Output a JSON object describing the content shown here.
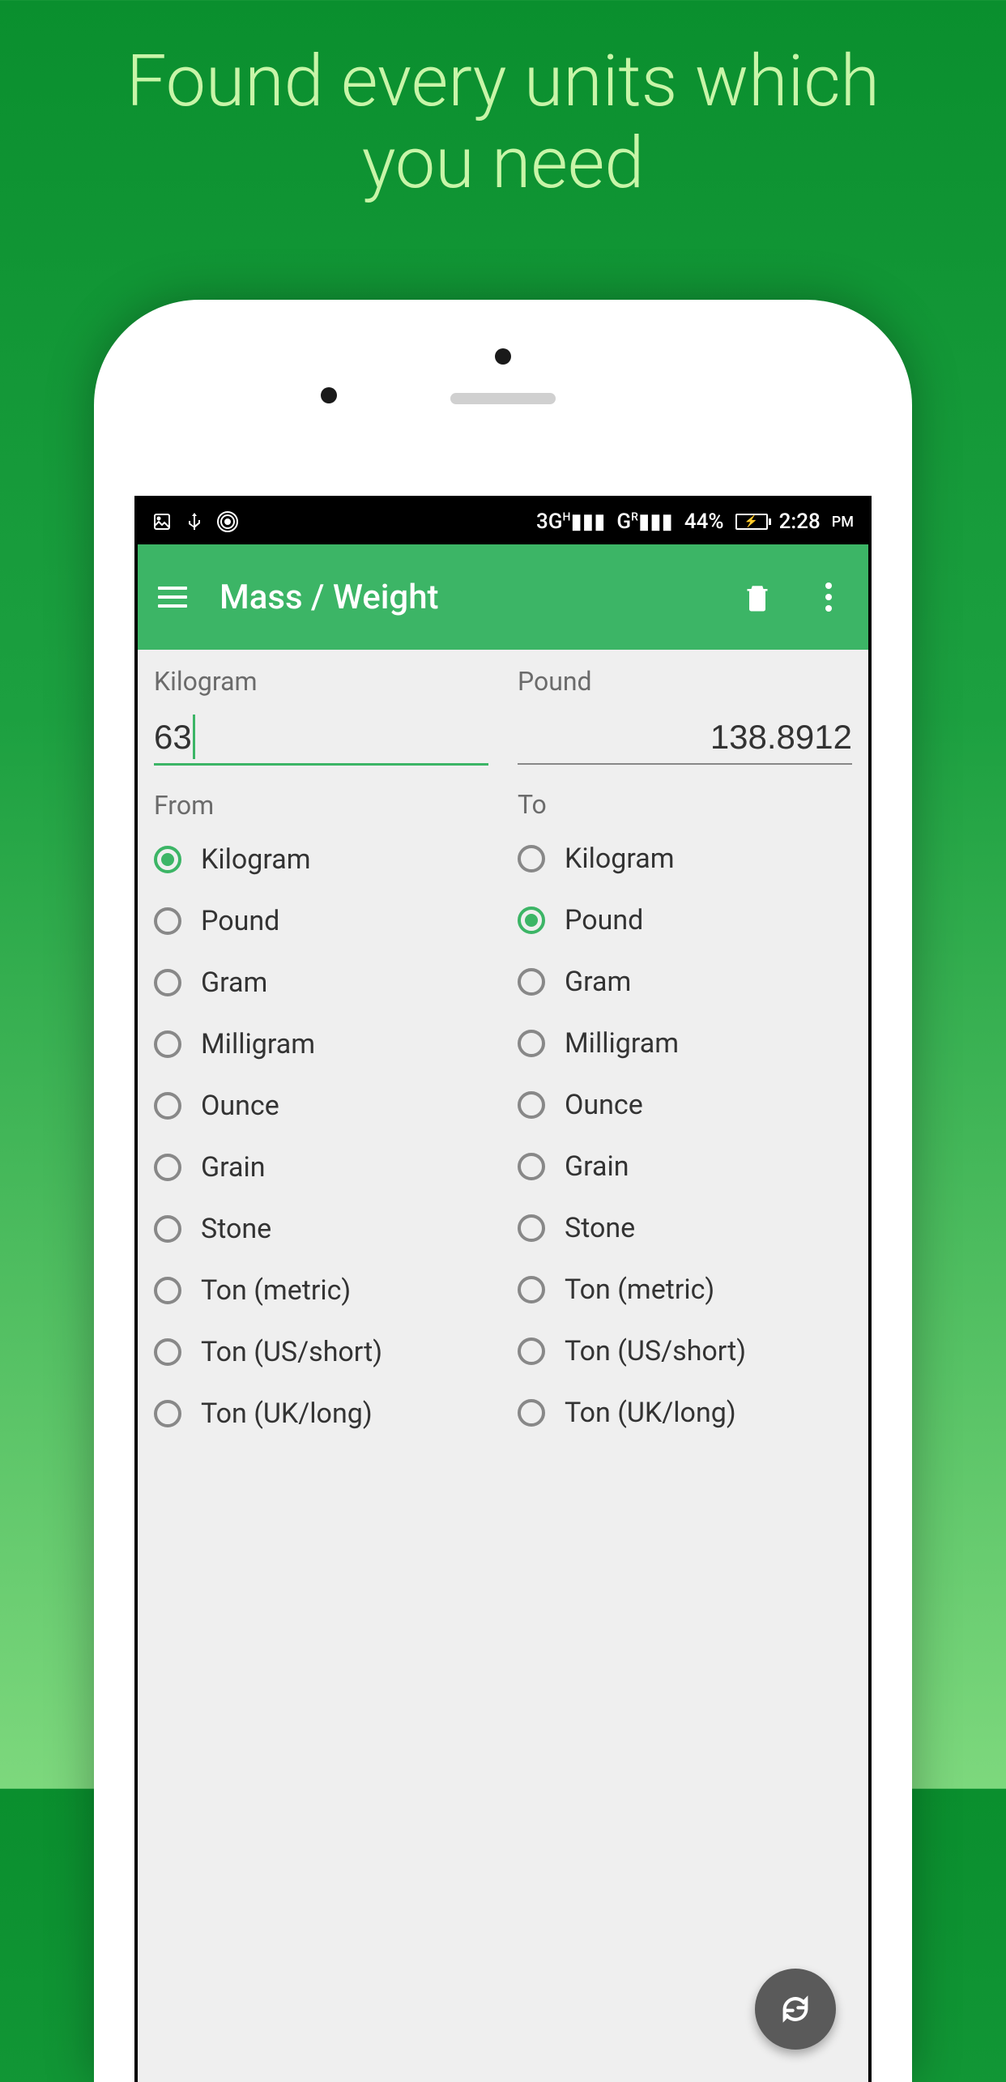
{
  "headline": "Found every units which you need",
  "status": {
    "signal1": "3G",
    "signal2": "G",
    "battery": "44%",
    "time": "2:28",
    "ampm": "PM"
  },
  "appbar": {
    "title": "Mass / Weight"
  },
  "from": {
    "label": "Kilogram",
    "value": "63",
    "section": "From",
    "selected": 0,
    "units": [
      "Kilogram",
      "Pound",
      "Gram",
      "Milligram",
      "Ounce",
      "Grain",
      "Stone",
      "Ton (metric)",
      "Ton (US/short)",
      "Ton (UK/long)"
    ]
  },
  "to": {
    "label": "Pound",
    "value": "138.8912",
    "section": "To",
    "selected": 1,
    "units": [
      "Kilogram",
      "Pound",
      "Gram",
      "Milligram",
      "Ounce",
      "Grain",
      "Stone",
      "Ton (metric)",
      "Ton (US/short)",
      "Ton (UK/long)"
    ]
  }
}
